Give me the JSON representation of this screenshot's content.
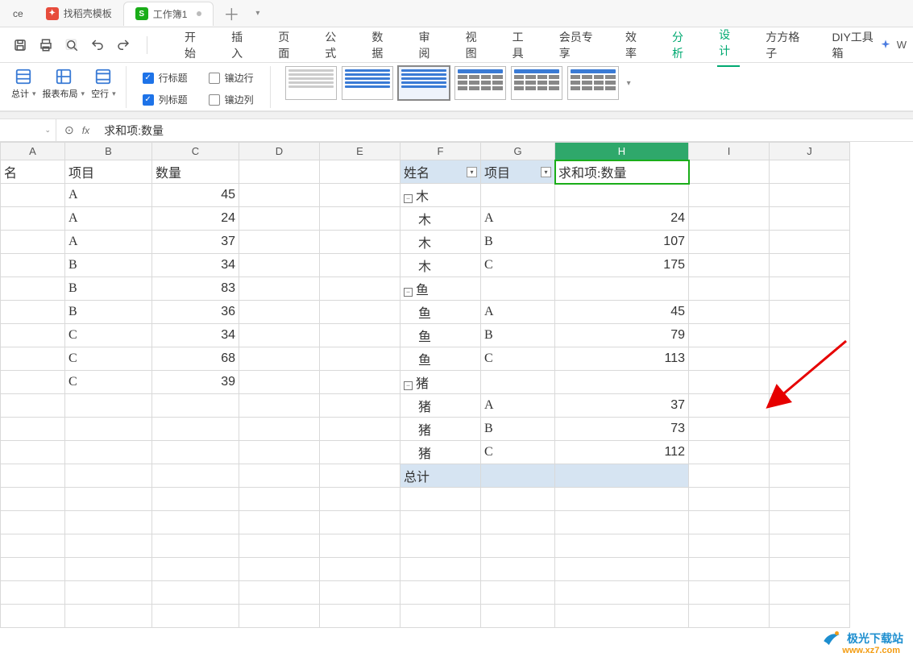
{
  "tabs": {
    "left_fragment": "ce",
    "template": "找稻壳模板",
    "workbook": "工作簿1"
  },
  "menu": {
    "start": "开始",
    "insert": "插入",
    "page": "页面",
    "formula": "公式",
    "data": "数据",
    "review": "审阅",
    "view": "视图",
    "tools": "工具",
    "member": "会员专享",
    "efficiency": "效率",
    "analysis": "分析",
    "design": "设计",
    "fangfang": "方方格子",
    "diy": "DIY工具箱",
    "right_fragment": "W"
  },
  "ribbon": {
    "subtotal": "总计",
    "report_layout": "报表布局",
    "blank_row": "空行",
    "row_header": "行标题",
    "col_header": "列标题",
    "banded_row": "镶边行",
    "banded_col": "镶边列"
  },
  "formula_bar": {
    "fx": "fx",
    "value": "求和项:数量"
  },
  "columns": [
    "A",
    "B",
    "C",
    "D",
    "E",
    "F",
    "G",
    "H",
    "I",
    "J"
  ],
  "left_table": {
    "hdr_name_fragment": "名",
    "hdr_item": "项目",
    "hdr_qty": "数量",
    "rows": [
      {
        "b": "A",
        "c": "45"
      },
      {
        "b": "A",
        "c": "24"
      },
      {
        "b": "A",
        "c": "37"
      },
      {
        "b": "B",
        "c": "34"
      },
      {
        "b": "B",
        "c": "83"
      },
      {
        "b": "B",
        "c": "36"
      },
      {
        "b": "C",
        "c": "34"
      },
      {
        "b": "C",
        "c": "68"
      },
      {
        "b": "C",
        "c": "39"
      }
    ]
  },
  "pivot": {
    "hdr_name": "姓名",
    "hdr_item": "项目",
    "hdr_sum": "求和项:数量",
    "group1": "木",
    "g1": [
      {
        "name": "木",
        "item": "A",
        "val": "24"
      },
      {
        "name": "木",
        "item": "B",
        "val": "107"
      },
      {
        "name": "木",
        "item": "C",
        "val": "175"
      }
    ],
    "group2": "鱼",
    "g2": [
      {
        "name": "鱼",
        "item": "A",
        "val": "45"
      },
      {
        "name": "鱼",
        "item": "B",
        "val": "79"
      },
      {
        "name": "鱼",
        "item": "C",
        "val": "113"
      }
    ],
    "group3": "猪",
    "g3": [
      {
        "name": "猪",
        "item": "A",
        "val": "37"
      },
      {
        "name": "猪",
        "item": "B",
        "val": "73"
      },
      {
        "name": "猪",
        "item": "C",
        "val": "112"
      }
    ],
    "total": "总计"
  },
  "watermark": {
    "text": "极光下载站",
    "url": "www.xz7.com"
  }
}
